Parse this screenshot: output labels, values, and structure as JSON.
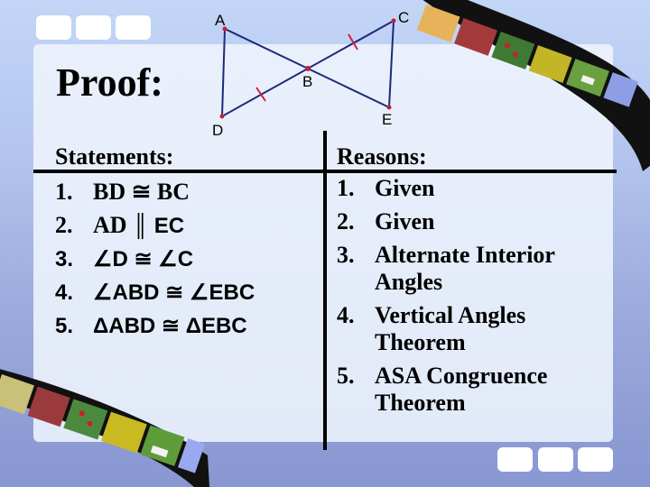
{
  "slide": {
    "title": "Proof:",
    "diagram": {
      "points": [
        {
          "label": "A"
        },
        {
          "label": "B"
        },
        {
          "label": "C"
        },
        {
          "label": "D"
        },
        {
          "label": "E"
        }
      ],
      "segments": [
        "AE",
        "DC",
        "AD",
        "CE"
      ],
      "tick_marks_on": [
        "DB",
        "BC"
      ],
      "colors": {
        "line": "#1c2a78",
        "point": "#c0203a",
        "tick": "#d0203a"
      }
    },
    "statements": {
      "header": "Statements:",
      "items": [
        {
          "num": "1.",
          "text": "BD ≅ BC"
        },
        {
          "num": "2.",
          "text_serif": "AD",
          "text_sans": "║ EC"
        },
        {
          "num": "3.",
          "text": "∠D ≅ ∠C"
        },
        {
          "num": "4.",
          "text": "∠ABD ≅ ∠EBC"
        },
        {
          "num": "5.",
          "text": "ΔABD ≅ ΔEBC"
        }
      ]
    },
    "reasons": {
      "header": "Reasons:",
      "items": [
        {
          "num": "1.",
          "text": "Given"
        },
        {
          "num": "2.",
          "text": "Given"
        },
        {
          "num": "3.",
          "text": "Alternate Interior Angles"
        },
        {
          "num": "4.",
          "text": "Vertical Angles Theorem"
        },
        {
          "num": "5.",
          "text": "ASA Congruence Theorem"
        }
      ]
    },
    "decoration": {
      "film_strip_frames": [
        "butterfly",
        "red-barn",
        "red-berries",
        "yellow-flowers",
        "mailbox",
        "sky"
      ]
    }
  }
}
